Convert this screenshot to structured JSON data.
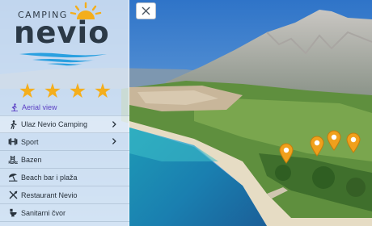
{
  "brand": {
    "top_text": "CAMPING",
    "main_text": "nevio"
  },
  "rating": {
    "stars": 4,
    "max": 4
  },
  "aerial_link": {
    "label": "Aerial view",
    "icon": "hiker-icon"
  },
  "menu": {
    "items": [
      {
        "label": "Ulaz Nevio Camping",
        "icon": "walking-person-icon",
        "has_submenu": true
      },
      {
        "label": "Sport",
        "icon": "dumbbell-icon",
        "has_submenu": true
      },
      {
        "label": "Bazen",
        "icon": "pool-icon",
        "has_submenu": false
      },
      {
        "label": "Beach bar i plaža",
        "icon": "umbrella-beach-icon",
        "has_submenu": false
      },
      {
        "label": "Restaurant Nevio",
        "icon": "utensils-icon",
        "has_submenu": false
      },
      {
        "label": "Sanitarni čvor",
        "icon": "toilet-icon",
        "has_submenu": false
      }
    ]
  },
  "close_button": {
    "icon": "close-icon"
  },
  "map_pins": [
    {
      "icon": "map-pin-icon"
    },
    {
      "icon": "map-pin-icon"
    },
    {
      "icon": "map-pin-icon"
    },
    {
      "icon": "map-pin-icon"
    }
  ],
  "colors": {
    "pin": "#f0a01c",
    "stars": "#f4ae1c",
    "link": "#5b3fc4",
    "brand": "#2b3946",
    "sun": "#f4ae1c",
    "waves": "#2aa0e0"
  }
}
